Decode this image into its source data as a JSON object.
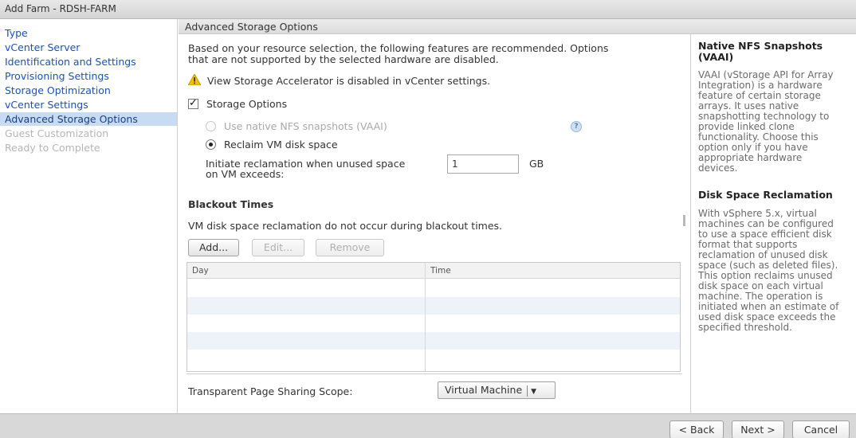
{
  "window": {
    "title": "Add Farm - RDSH-FARM"
  },
  "sidebar": {
    "items": [
      {
        "label": "Type",
        "state": "link"
      },
      {
        "label": "vCenter Server",
        "state": "link"
      },
      {
        "label": "Identification and Settings",
        "state": "link"
      },
      {
        "label": "Provisioning Settings",
        "state": "link"
      },
      {
        "label": "Storage Optimization",
        "state": "link"
      },
      {
        "label": "vCenter Settings",
        "state": "link"
      },
      {
        "label": "Advanced Storage Options",
        "state": "active"
      },
      {
        "label": "Guest Customization",
        "state": "disabled"
      },
      {
        "label": "Ready to Complete",
        "state": "disabled"
      }
    ]
  },
  "main": {
    "section_title": "Advanced Storage Options",
    "intro_line1": "Based on your resource selection, the following features are recommended. Options",
    "intro_line2": "that are not supported by the selected hardware are disabled.",
    "warning": "View Storage Accelerator is disabled in vCenter settings.",
    "storage_options_label": "Storage Options",
    "storage_options_checked": true,
    "option_vaai": "Use native NFS snapshots (VAAI)",
    "option_reclaim": "Reclaim VM disk space",
    "reclaim_label_line1": "Initiate reclamation when unused space",
    "reclaim_label_line2": "on VM exceeds:",
    "reclaim_value": "1",
    "reclaim_unit": "GB",
    "blackout_title": "Blackout Times",
    "blackout_desc": "VM disk space reclamation do not occur during blackout times.",
    "buttons": {
      "add": "Add...",
      "edit": "Edit...",
      "remove": "Remove"
    },
    "table": {
      "columns": [
        "Day",
        "Time"
      ],
      "rows": []
    },
    "tps_label": "Transparent Page Sharing Scope:",
    "tps_value": "Virtual Machine"
  },
  "help": {
    "heading1": "Native NFS Snapshots\n(VAAI)",
    "para1": "VAAI (vStorage API for Array\nIntegration) is a hardware\nfeature of certain storage\narrays. It uses native\nsnapshotting technology to\nprovide linked clone\nfunctionality. Choose this\noption only if you have\nappropriate hardware\ndevices.",
    "heading2": "Disk Space Reclamation",
    "para2": "With vSphere 5.x, virtual\nmachines can be configured\nto use a space efficient disk\nformat that supports\nreclamation of unused disk\nspace (such as deleted files).\nThis option reclaims unused\ndisk space on each virtual\nmachine. The operation is\ninitiated when an estimate of\nused disk space exceeds the\nspecified threshold."
  },
  "footer": {
    "back": "< Back",
    "next": "Next >",
    "cancel": "Cancel"
  }
}
